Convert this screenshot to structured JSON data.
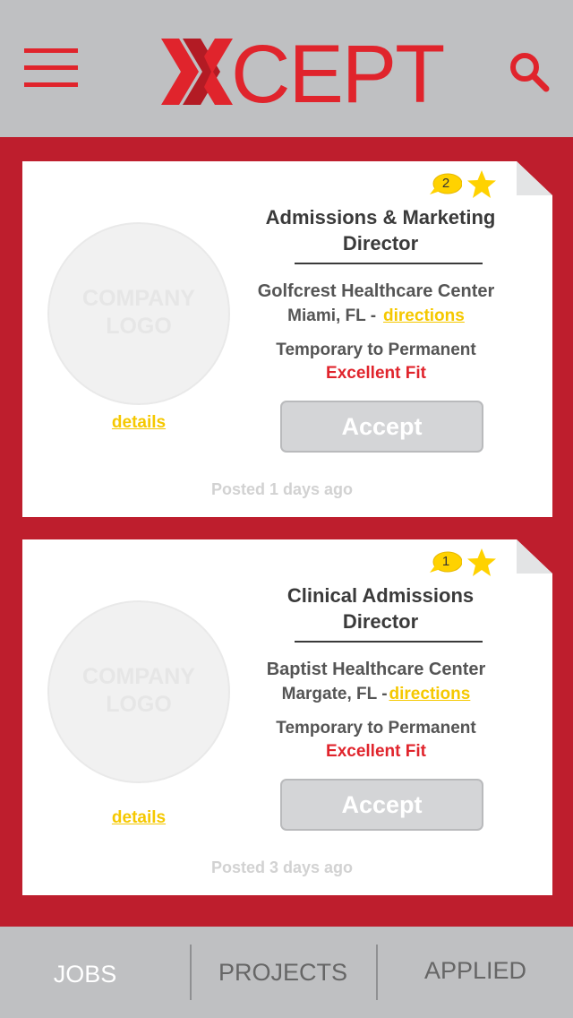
{
  "header": {
    "logo_text": "CEPT",
    "brand_color": "#e0242c"
  },
  "jobs": [
    {
      "badge_count": "2",
      "title": "Admissions & Marketing\nDirector",
      "logo_placeholder": "COMPANY\nLOGO",
      "details_label": "details",
      "company": "Golfcrest Healthcare Center",
      "location": "Miami, FL -",
      "directions_label": "directions",
      "job_type": "Temporary to Permanent",
      "fit": "Excellent Fit",
      "accept_label": "Accept",
      "posted": "Posted 1 days ago"
    },
    {
      "badge_count": "1",
      "title": "Clinical Admissions\nDirector",
      "logo_placeholder": "COMPANY\nLOGO",
      "details_label": "details",
      "company": "Baptist Healthcare Center",
      "location": "Margate, FL -",
      "directions_label": "directions",
      "job_type": "Temporary to Permanent",
      "fit": "Excellent Fit",
      "accept_label": "Accept",
      "posted": "Posted 3 days ago"
    }
  ],
  "nav": {
    "tabs": [
      {
        "label": "JOBS",
        "active": true
      },
      {
        "label": "PROJECTS",
        "active": false
      },
      {
        "label": "APPLIED",
        "active": false
      }
    ]
  },
  "colors": {
    "header_bg": "#bfc0c2",
    "main_bg": "#be1e2d",
    "link": "#f5c800",
    "star": "#ffd200"
  }
}
